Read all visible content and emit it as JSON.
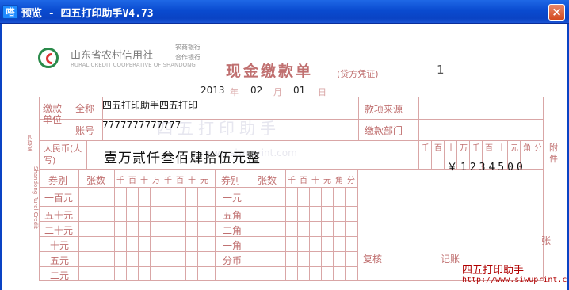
{
  "window": {
    "icon_text": "嗒",
    "title": "预览 - 四五打印助手V4.73",
    "close_label": "×"
  },
  "bank": {
    "name": "山东省农村信用社",
    "sub1": "农商银行",
    "sub2": "合作银行",
    "name_en": "RURAL CREDIT COOPERATIVE OF SHANDONG"
  },
  "doc": {
    "title": "现金缴款单",
    "subtitle": "(贷方凭证)",
    "number": "1"
  },
  "date": {
    "year": "2013",
    "year_label": "年",
    "month": "02",
    "month_label": "月",
    "day": "01",
    "day_label": "日"
  },
  "payer": {
    "section_label": "缴款单位",
    "name_label": "全称",
    "name_value": "四五打印助手四五打印",
    "account_label": "账号",
    "account_value": "7777777777777",
    "source_label": "款项来源",
    "dept_label": "缴款部门"
  },
  "amount": {
    "rmb_label": "人民币(大写)",
    "words": "壹万贰仟叁佰肆拾伍元整",
    "digit_headers": [
      "千",
      "百",
      "十",
      "万",
      "千",
      "百",
      "十",
      "元",
      "角",
      "分"
    ],
    "figures": "￥1234500",
    "attach_label": "附件"
  },
  "denom": {
    "left_header": "券别",
    "count_header": "张数",
    "left_digit_headers": [
      "千",
      "百",
      "十",
      "万",
      "千",
      "百",
      "十",
      "元"
    ],
    "left_rows": [
      "一百元",
      "五十元",
      "二十元",
      "十元",
      "五元",
      "二元"
    ],
    "right_header": "券别",
    "right_count_header": "张数",
    "right_digit_headers": [
      "千",
      "百",
      "十",
      "元",
      "角",
      "分"
    ],
    "right_rows": [
      "一元",
      "五角",
      "二角",
      "一角",
      "分币"
    ]
  },
  "footer": {
    "review_label": "复核",
    "record_label": "记账",
    "zhang": "张"
  },
  "watermark": {
    "text": "四五打印助手",
    "url": "www.siwuprint.com"
  },
  "brand": {
    "name": "四五打印助手",
    "url": "http://www.siwuprint.com"
  },
  "side_text": {
    "left1": "四联单",
    "left2": "Shandong Rural Credit"
  }
}
